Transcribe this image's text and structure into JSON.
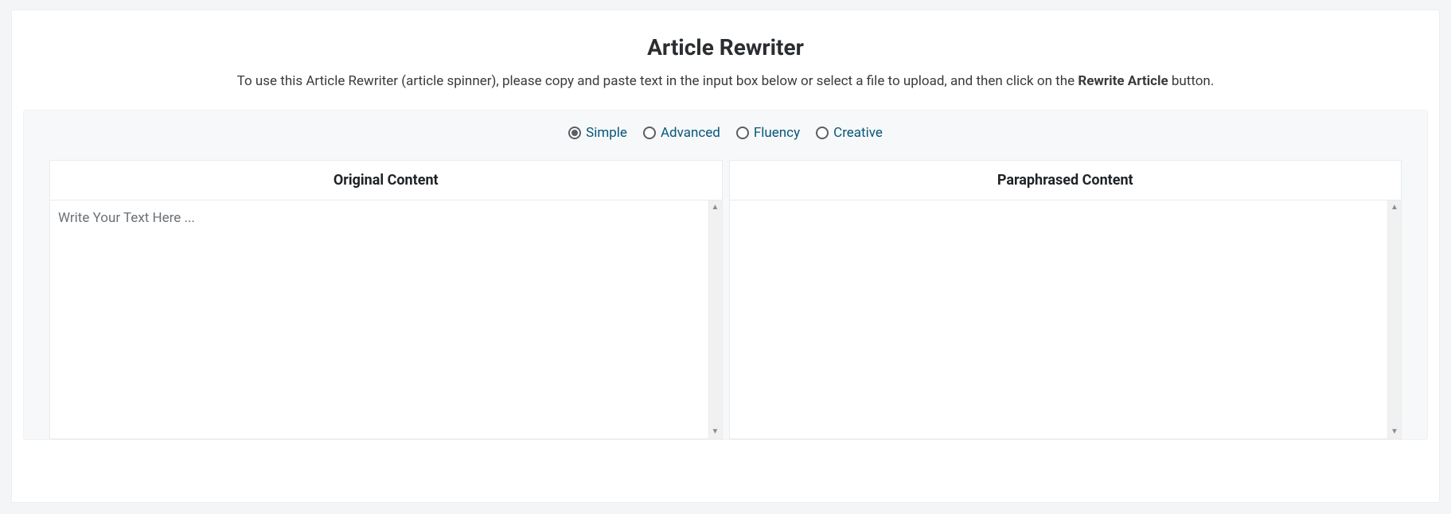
{
  "page": {
    "title": "Article Rewriter",
    "subtitle_prefix": "To use this Article Rewriter (article spinner), please copy and paste text in the input box below or select a file to upload, and then click on the ",
    "subtitle_strong": "Rewrite Article",
    "subtitle_suffix": " button."
  },
  "modes": {
    "options": [
      {
        "id": "simple",
        "label": "Simple",
        "selected": true
      },
      {
        "id": "advanced",
        "label": "Advanced",
        "selected": false
      },
      {
        "id": "fluency",
        "label": "Fluency",
        "selected": false
      },
      {
        "id": "creative",
        "label": "Creative",
        "selected": false
      }
    ]
  },
  "panels": {
    "original": {
      "header": "Original Content",
      "placeholder": "Write Your Text Here ...",
      "value": ""
    },
    "paraphrased": {
      "header": "Paraphrased Content",
      "value": ""
    }
  }
}
